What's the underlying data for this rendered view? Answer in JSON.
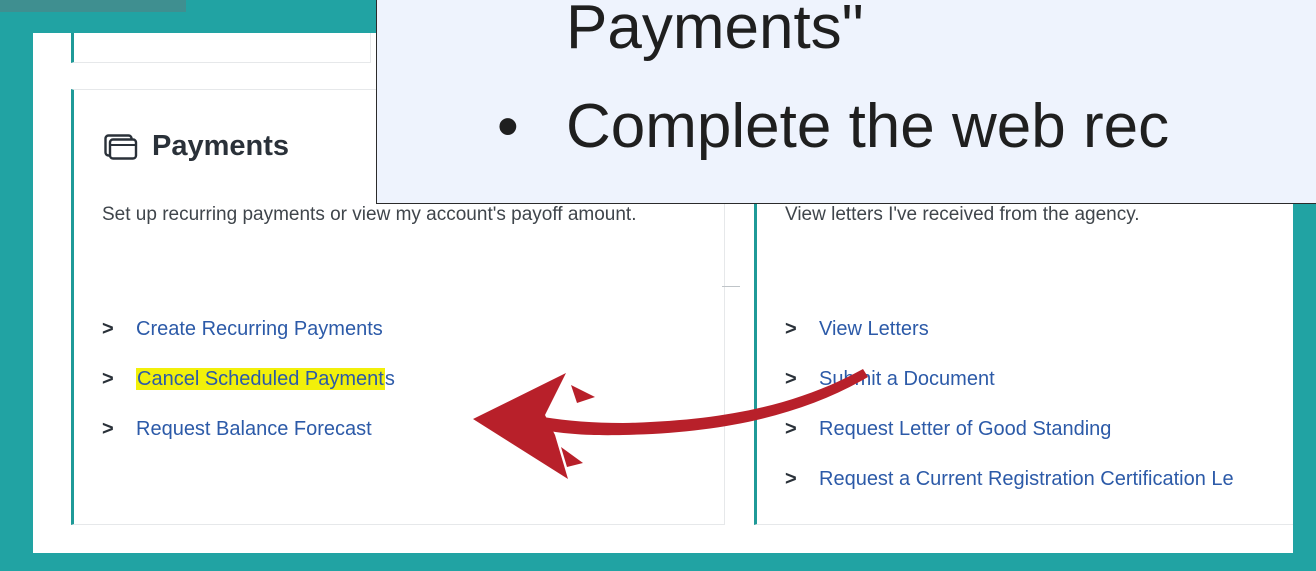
{
  "overlay": {
    "line1": "Payments\"",
    "bullet": "•",
    "line2": "Complete the web rec"
  },
  "payments_card": {
    "title": "Payments",
    "icon": "wallet-icon",
    "description": "Set up recurring payments or view my account's payoff amount.",
    "links": [
      {
        "label": "Create Recurring Payments",
        "highlighted": false
      },
      {
        "label_highlighted": "Cancel Scheduled Payment",
        "label_rest": "s",
        "highlighted": true
      },
      {
        "label": "Request Balance Forecast",
        "highlighted": false
      }
    ]
  },
  "documents_card": {
    "description": "View letters I've received from the agency.",
    "links": [
      {
        "label": "View Letters"
      },
      {
        "label": "Submit a Document"
      },
      {
        "label": "Request Letter of Good Standing"
      },
      {
        "label": "Request a Current Registration Certification Le"
      }
    ]
  },
  "colors": {
    "teal_border": "#21a3a3",
    "link_blue": "#2c5aa8",
    "highlight_yellow": "#f2f00a",
    "arrow_red": "#b8202a",
    "overlay_bg": "#eef3fd"
  },
  "chevron_glyph": ">"
}
